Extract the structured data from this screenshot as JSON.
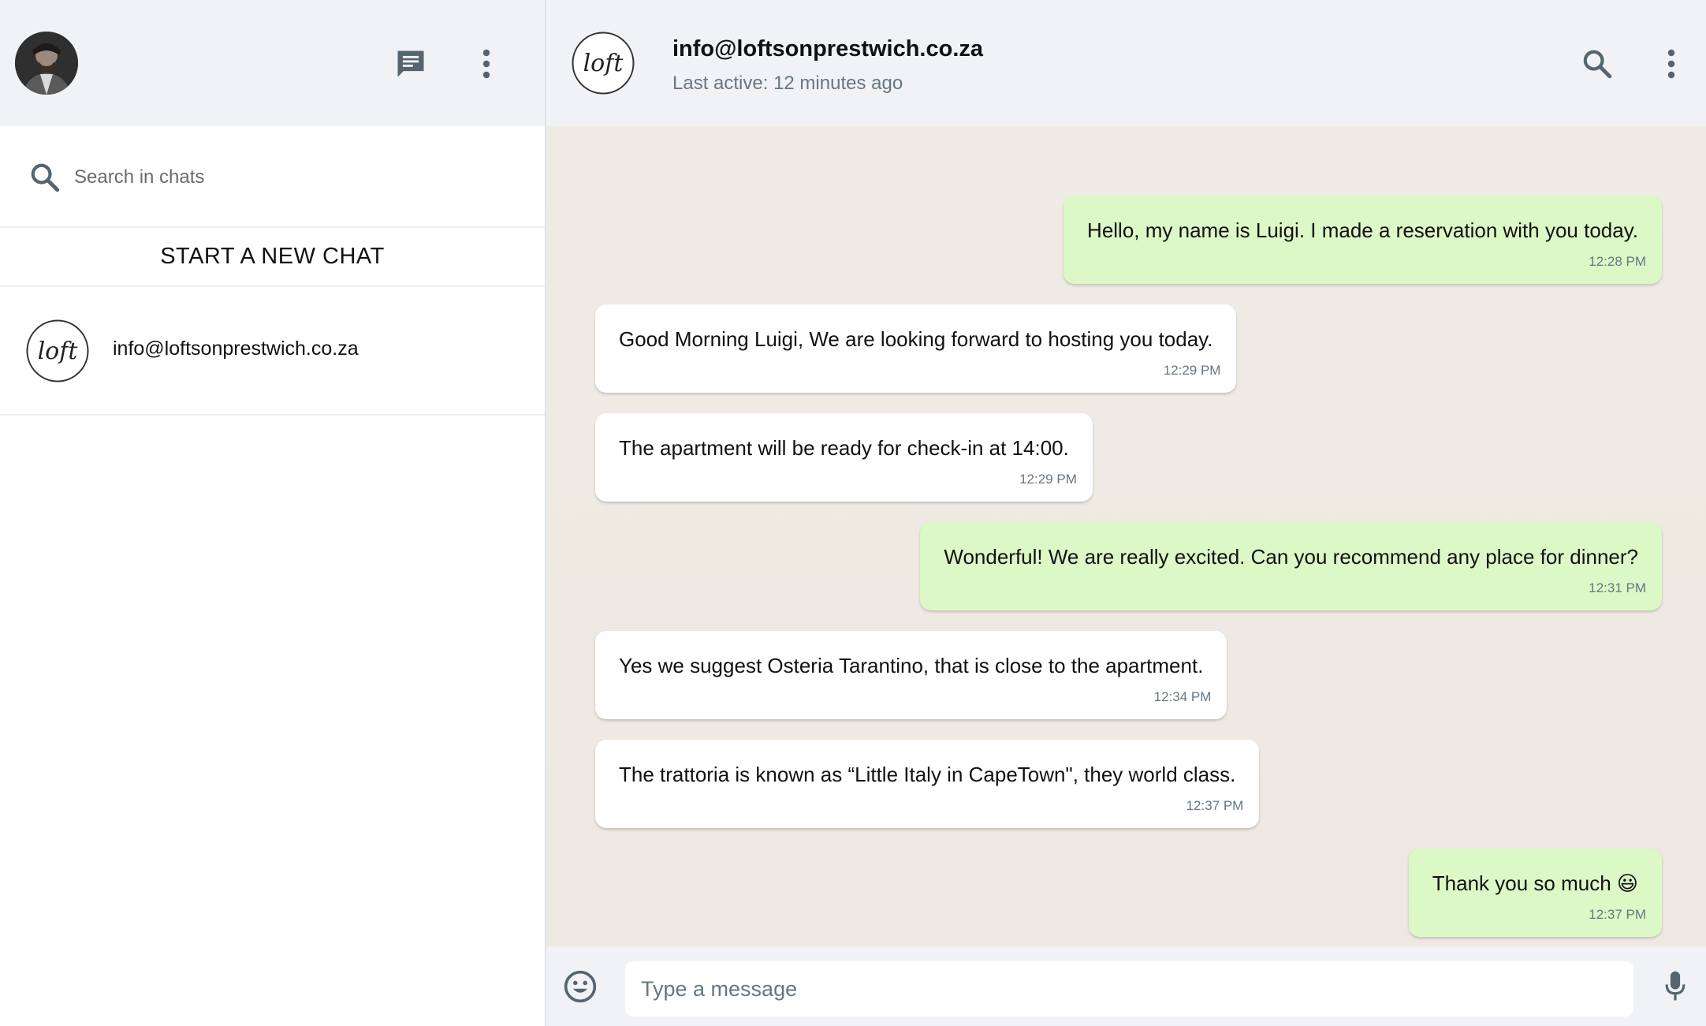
{
  "sidebar": {
    "search": {
      "placeholder": "Search in chats"
    },
    "new_chat_label": "START A NEW CHAT",
    "chats": [
      {
        "name": "info@loftsonprestwich.co.za"
      }
    ]
  },
  "chat": {
    "contact_name": "info@loftsonprestwich.co.za",
    "status": "Last active: 12 minutes ago",
    "messages": [
      {
        "direction": "out",
        "text": "Hello, my name is Luigi. I made a reservation with you today.",
        "time": "12:28 PM"
      },
      {
        "direction": "in",
        "text": "Good Morning Luigi, We are looking forward to hosting you today.",
        "time": "12:29 PM"
      },
      {
        "direction": "in",
        "text": "The apartment will be ready for check-in at 14:00.",
        "time": "12:29 PM"
      },
      {
        "direction": "out",
        "text": "Wonderful! We are really excited. Can you recommend any place for dinner?",
        "time": "12:31 PM"
      },
      {
        "direction": "in",
        "text": "Yes we suggest Osteria Tarantino, that is close to the apartment.",
        "time": "12:34 PM"
      },
      {
        "direction": "in",
        "text": "The trattoria is known as “Little Italy in CapeTown\", they world class.",
        "time": "12:37 PM"
      },
      {
        "direction": "out",
        "text": "Thank you so much 😃",
        "time": "12:37 PM"
      }
    ],
    "composer": {
      "placeholder": "Type a message"
    }
  },
  "icons": {
    "new_chat": "chat-icon",
    "menu": "vertical-dots-icon",
    "search": "search-icon",
    "emoji": "emoji-icon",
    "mic": "microphone-icon"
  },
  "colors": {
    "header_bg": "#f0f2f5",
    "outgoing_bubble": "#dcf8c6",
    "incoming_bubble": "#ffffff",
    "chat_bg": "#efeae2"
  }
}
